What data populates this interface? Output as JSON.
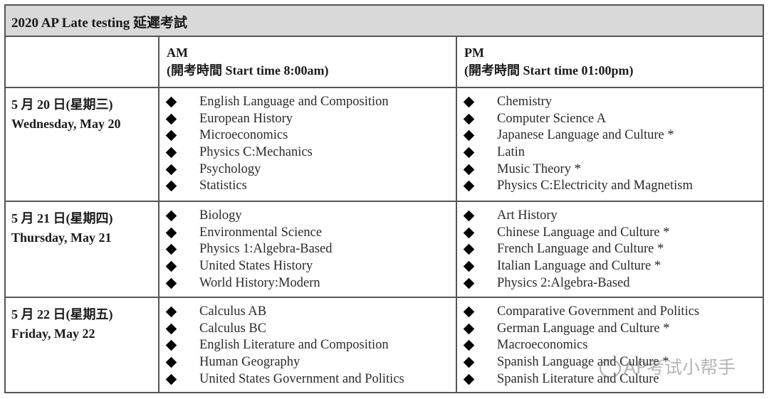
{
  "title": "2020 AP Late testing 延遲考試",
  "header": {
    "am": {
      "label": "AM",
      "time": "(開考時間 Start time 8:00am)"
    },
    "pm": {
      "label": "PM",
      "time": "(開考時間 Start time 01:00pm)"
    }
  },
  "rows": [
    {
      "date_cn": "5 月 20 日(星期三)",
      "date_en": "Wednesday, May 20",
      "am": [
        "English Language and Composition",
        "European History",
        "Microeconomics",
        "Physics C:Mechanics",
        "Psychology",
        "Statistics"
      ],
      "pm": [
        "Chemistry",
        "Computer Science A",
        "Japanese Language and Culture *",
        "Latin",
        "Music Theory *",
        "Physics C:Electricity and Magnetism"
      ]
    },
    {
      "date_cn": "5 月 21 日(星期四)",
      "date_en": "Thursday, May 21",
      "am": [
        "Biology",
        "Environmental Science",
        "Physics 1:Algebra-Based",
        "United States History",
        "World History:Modern"
      ],
      "pm": [
        "Art History",
        "Chinese Language and Culture *",
        "French Language and Culture *",
        "Italian Language and Culture *",
        "Physics 2:Algebra-Based"
      ]
    },
    {
      "date_cn": "5 月 22 日(星期五)",
      "date_en": "Friday, May 22",
      "am": [
        "Calculus AB",
        "Calculus BC",
        "English Literature and Composition",
        "Human Geography",
        "United States Government and Politics"
      ],
      "pm": [
        "Comparative Government and Politics",
        "German Language and Culture *",
        "Macroeconomics",
        "Spanish Language and Culture *",
        "Spanish Literature and Culture"
      ]
    }
  ],
  "watermark": {
    "icon": "wechat-icon",
    "text": "AP考试小帮手"
  }
}
